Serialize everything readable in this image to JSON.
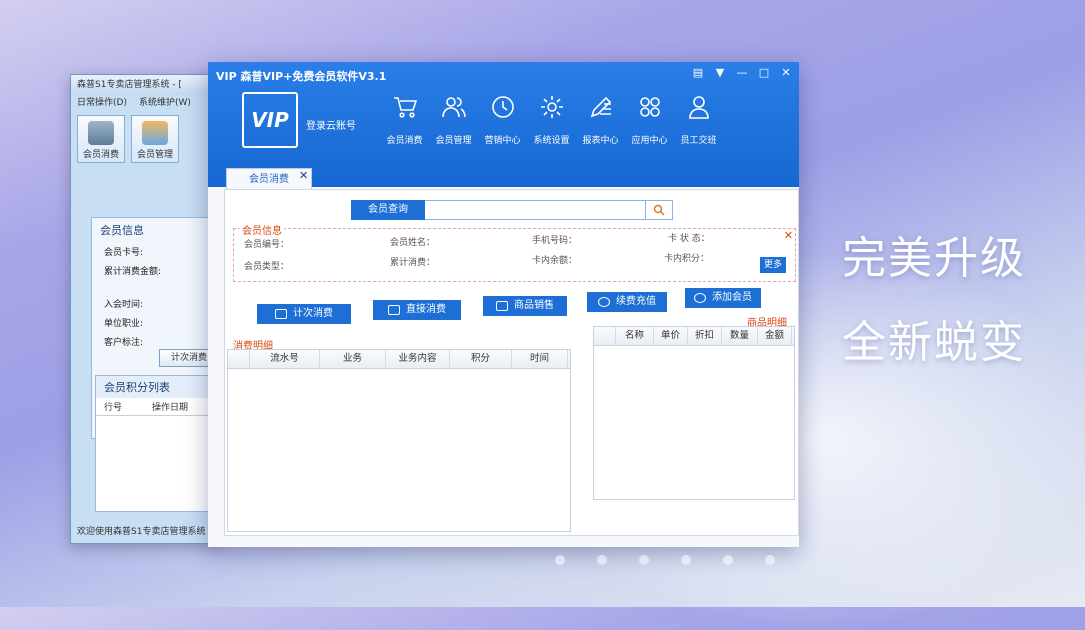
{
  "slogans": [
    "完美升级",
    "全新蜕变"
  ],
  "back_window": {
    "title": "森普S1专卖店管理系统 - [",
    "menu": [
      "日常操作(D)",
      "系统维护(W)"
    ],
    "tools": [
      "会员消费",
      "会员管理"
    ],
    "panel_title": "会员信息",
    "fields": [
      "会员卡号:",
      "累计消费金额:",
      "入会时间:",
      "单位职业:",
      "客户标注:"
    ],
    "button": "计次消费",
    "list_title": "会员积分列表",
    "list_cols": [
      "行号",
      "操作日期"
    ],
    "status": "欢迎使用森普S1专卖店管理系统"
  },
  "main_window": {
    "title": "VIP 森普VIP+免费会员软件V3.1",
    "logo": "VIP",
    "login": "登录云账号",
    "nav": [
      {
        "label": "会员消费",
        "icon": "cart-icon"
      },
      {
        "label": "会员管理",
        "icon": "users-icon"
      },
      {
        "label": "营销中心",
        "icon": "clock-icon"
      },
      {
        "label": "系统设置",
        "icon": "gear-icon"
      },
      {
        "label": "报表中心",
        "icon": "pen-icon"
      },
      {
        "label": "应用中心",
        "icon": "apps-icon"
      },
      {
        "label": "员工交班",
        "icon": "person-icon"
      }
    ],
    "tab": "会员消费",
    "search_label": "会员查询",
    "search_value": "",
    "info": {
      "legend": "会员信息",
      "labels": {
        "member_no": "会员编号：",
        "member_type": "会员类型：",
        "member_name": "会员姓名：",
        "total_spent": "累计消费：",
        "phone": "手机号码：",
        "balance": "卡内余额：",
        "card_status": "卡 状 态：",
        "points": "卡内积分："
      },
      "more": "更多"
    },
    "actions": [
      "计次消费",
      "直接消费",
      "商品销售",
      "续费充值",
      "添加会员"
    ],
    "consume_title": "消费明细",
    "consume_cols": [
      "",
      "流水号",
      "业务",
      "业务内容",
      "积分",
      "时间"
    ],
    "goods_title": "商品明细",
    "goods_cols": [
      "",
      "名称",
      "单价",
      "折扣",
      "数量",
      "金额"
    ]
  }
}
